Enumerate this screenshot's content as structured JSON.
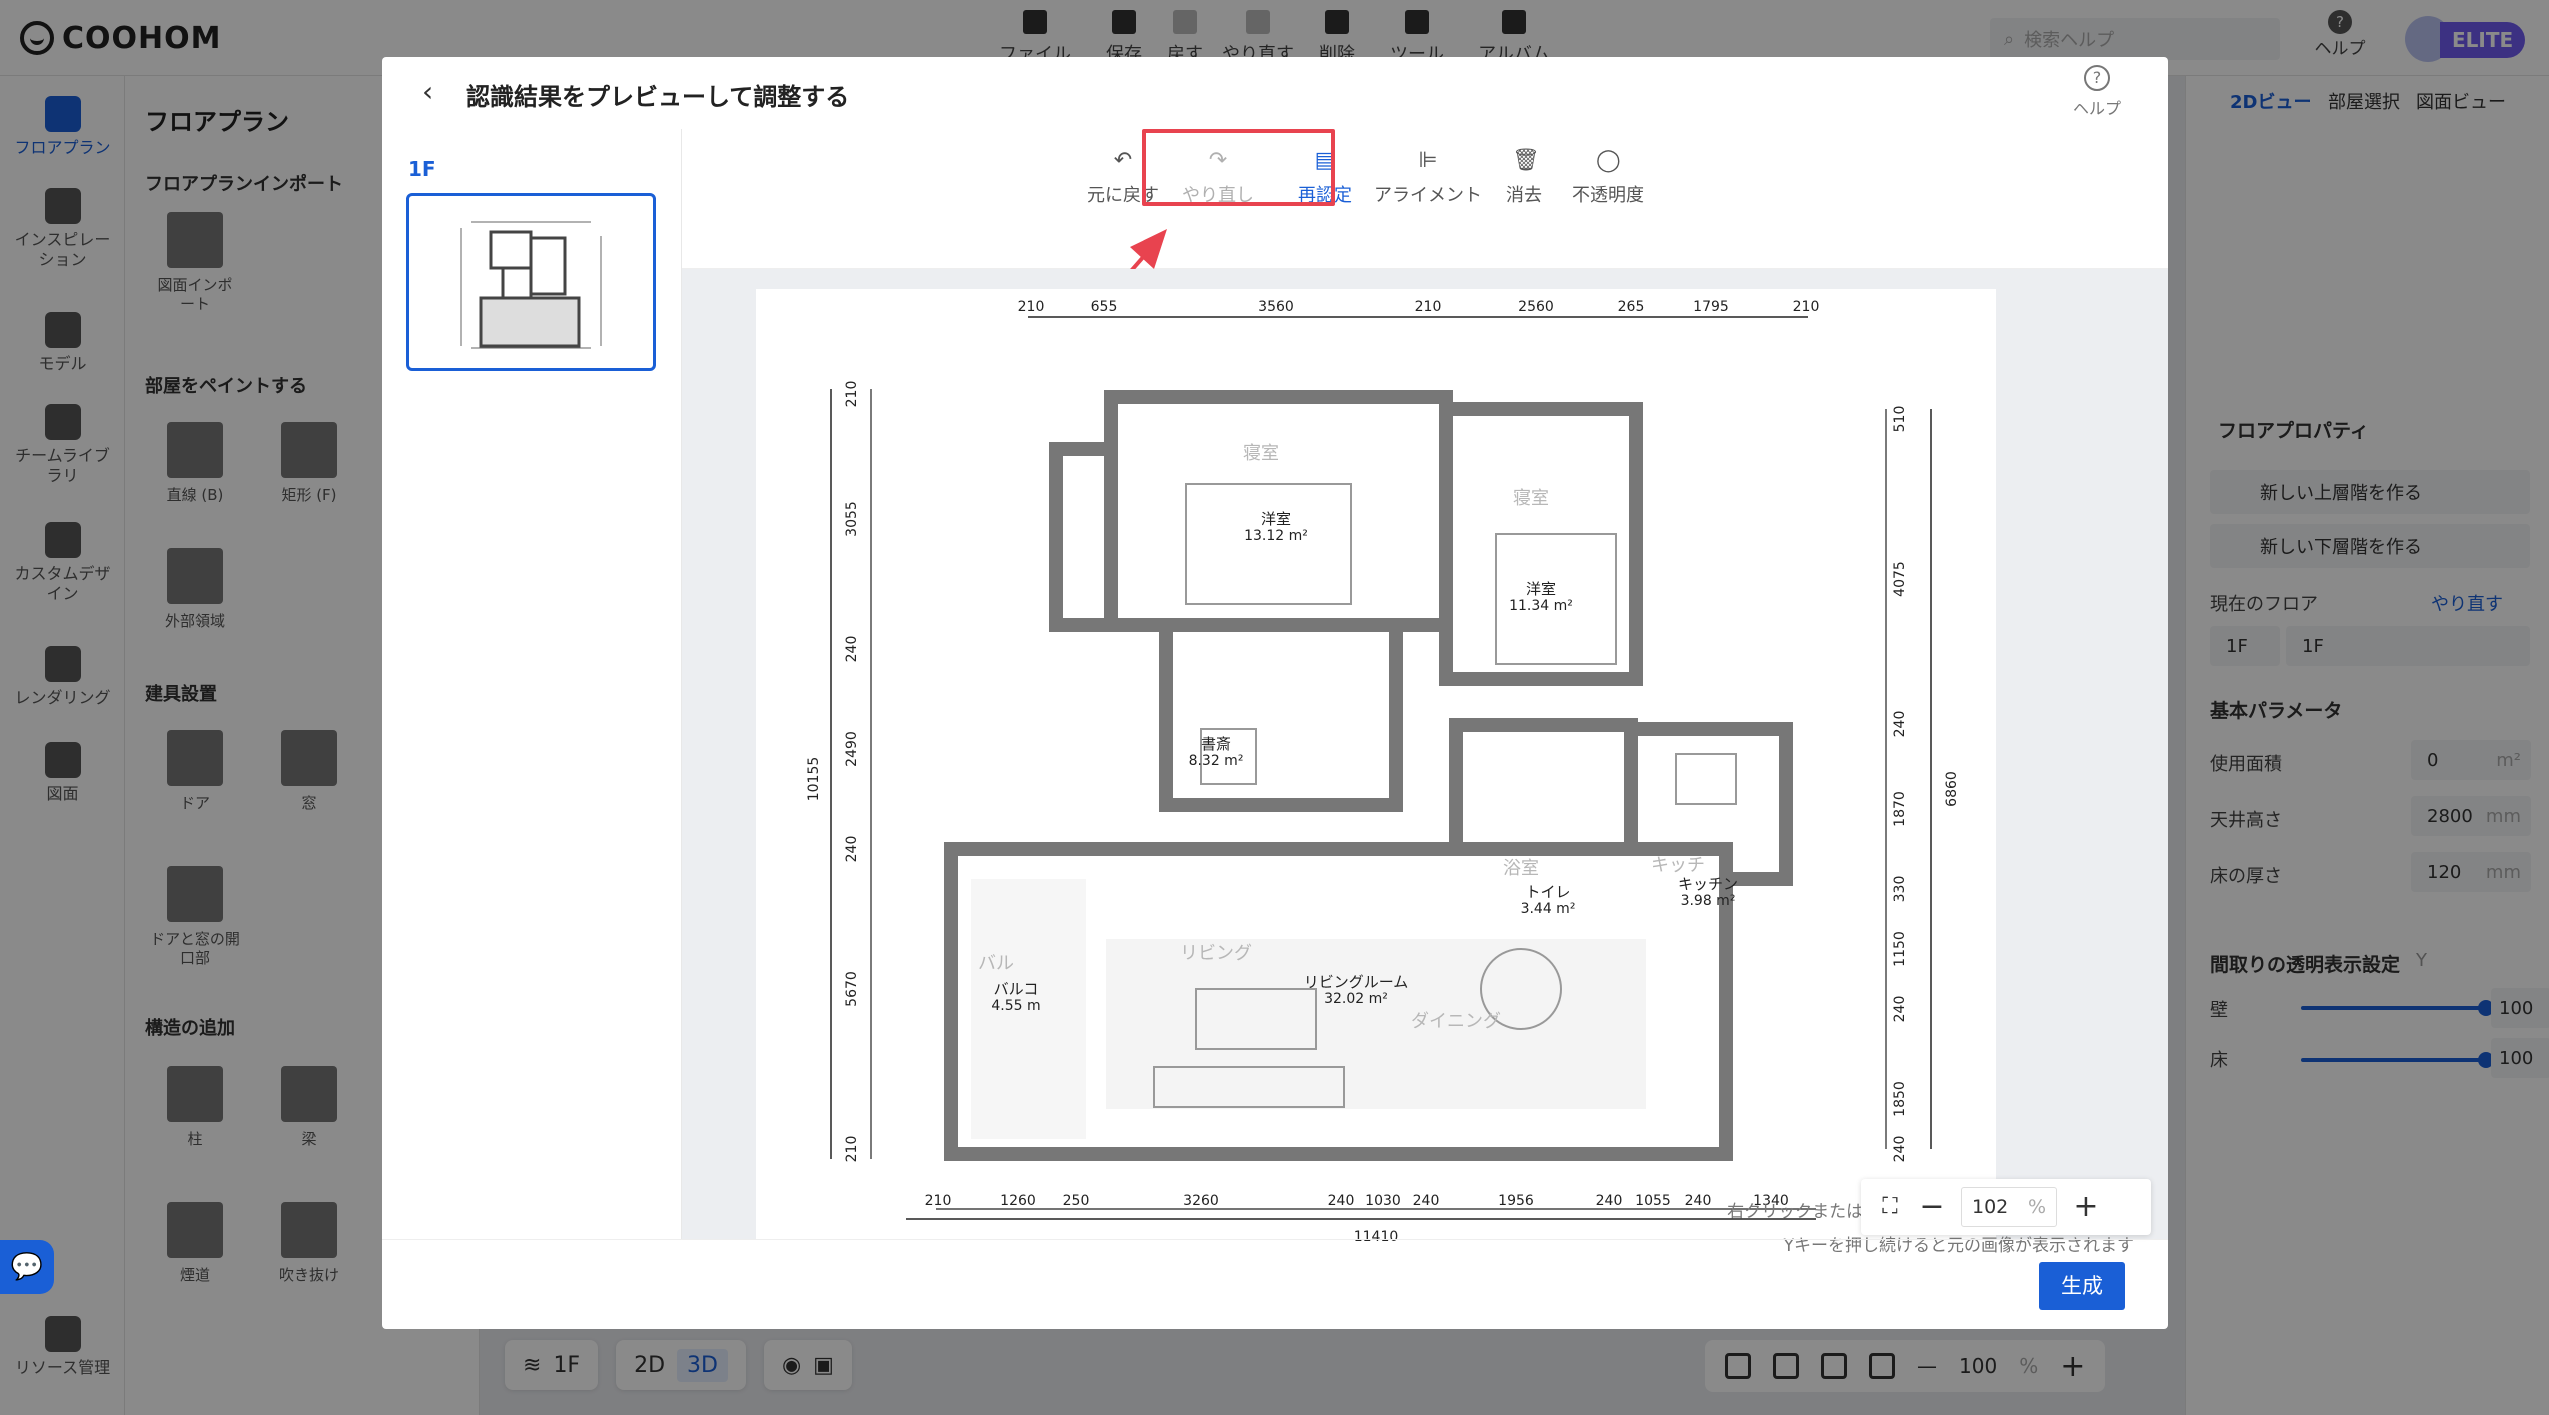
{
  "app": {
    "logo": "COOHOM",
    "top_tools": [
      "ファイル",
      "保存",
      "戻す",
      "やり直す",
      "削除",
      "ツール",
      "アルバム"
    ],
    "search_placeholder": "検索ヘルプ",
    "help": "ヘルプ",
    "badge": "ELITE"
  },
  "left_nav": [
    {
      "label": "フロアプラン",
      "icon": "floorplan-icon",
      "active": true
    },
    {
      "label": "インスピレーション",
      "icon": "bulb-icon",
      "active": false
    },
    {
      "label": "モデル",
      "icon": "sofa-icon",
      "active": false
    },
    {
      "label": "チームライブラリ",
      "icon": "crown-icon",
      "active": false
    },
    {
      "label": "カスタムデザイン",
      "icon": "box-icon",
      "active": false
    },
    {
      "label": "レンダリング",
      "icon": "camera-icon",
      "active": false
    },
    {
      "label": "図面",
      "icon": "drawing-icon",
      "active": false
    },
    {
      "label": "リソース管理",
      "icon": "resource-icon",
      "active": false
    }
  ],
  "left_panel": {
    "title": "フロアプラン",
    "import_section": "フロアプランインポート",
    "import_label": "図面インポート",
    "paint_section": "部屋をペイントする",
    "paint_tools": [
      "直線 (B)",
      "矩形 (F)",
      "外部領域"
    ],
    "fixture_section": "建具設置",
    "fixtures": [
      "ドア",
      "窓",
      "ドアと窓の開口部"
    ],
    "structure_section": "構造の追加",
    "structures": [
      "柱",
      "梁",
      "煙道",
      "吹き抜け"
    ]
  },
  "right_panel": {
    "tabs": [
      "2Dビュー",
      "部屋選択",
      "図面ビュー"
    ],
    "floor_props": "フロアプロパティ",
    "btn_upper": "新しい上層階を作る",
    "btn_lower": "新しい下層階を作る",
    "current_floor": "現在のフロア",
    "current_floor_link": "やり直す",
    "floor_select": "1F",
    "floor_name": "1F",
    "basic_params": "基本パラメータ",
    "usage_area": "使用面積",
    "usage_area_value": "0",
    "usage_area_unit": "m²",
    "ceiling_height": "天井高さ",
    "ceiling_height_value": "2800",
    "ceiling_height_unit": "mm",
    "floor_thickness": "床の厚さ",
    "floor_thickness_value": "120",
    "floor_thickness_unit": "mm",
    "transparency": "間取りの透明表示設定",
    "transparency_key": "Y",
    "wall": "壁",
    "wall_value": "100",
    "floor": "床",
    "floor_value": "100",
    "percent": "%"
  },
  "bottom_bar": {
    "floor": "1F",
    "view2d": "2D",
    "view3d": "3D",
    "zoom": "100",
    "percent": "%"
  },
  "modal": {
    "title": "認識結果をプレビューして調整する",
    "help": "ヘルプ",
    "floor_tab": "1F",
    "tools": [
      {
        "label": "元に戻す",
        "icon": "undo-icon",
        "state": "normal"
      },
      {
        "label": "やり直し",
        "icon": "redo-icon",
        "state": "disabled"
      },
      {
        "label": "再認定",
        "icon": "ai-recognize-icon",
        "state": "active"
      },
      {
        "label": "アライメント",
        "icon": "align-icon",
        "state": "normal"
      },
      {
        "label": "消去",
        "icon": "trash-icon",
        "state": "normal"
      },
      {
        "label": "不透明度",
        "icon": "opacity-icon",
        "state": "normal"
      }
    ],
    "hint1": "右クリックまたはESCキーを押して操作を終了します",
    "hint2": "Yキーを押し続けると元の画像が表示されます",
    "zoom_value": "102",
    "zoom_unit": "%",
    "generate": "生成"
  },
  "floorplan": {
    "top_dims": [
      "210",
      "655",
      "3560",
      "210",
      "2560",
      "265",
      "1795",
      "210"
    ],
    "bottom_dims": [
      "210",
      "1260",
      "250",
      "3260",
      "240",
      "1030",
      "240",
      "1956",
      "240",
      "1055",
      "240",
      "1340"
    ],
    "bottom_total": "11410",
    "left_dims": [
      "210",
      "3055",
      "240",
      "2490",
      "240",
      "5670",
      "210"
    ],
    "left_total": "10155",
    "right_dims": [
      "510",
      "4075",
      "240",
      "1870",
      "330",
      "1150",
      "240",
      "1850",
      "240"
    ],
    "right_total": "6860",
    "rooms": [
      {
        "name": "寝室",
        "faded": true
      },
      {
        "name": "洋室",
        "area": "13.12 m²"
      },
      {
        "name": "寝室",
        "faded": true
      },
      {
        "name": "洋室",
        "area": "11.34 m²"
      },
      {
        "name": "書斎",
        "area": "8.32 m²"
      },
      {
        "name": "浴室",
        "faded": true
      },
      {
        "name": "トイレ",
        "area": "3.44 m²"
      },
      {
        "name": "キッチ",
        "faded": true
      },
      {
        "name": "キッチン",
        "area": "3.98 m²"
      },
      {
        "name": "リビング",
        "faded": true
      },
      {
        "name": "リビングルーム",
        "area": "32.02 m²"
      },
      {
        "name": "バル",
        "faded": true
      },
      {
        "name": "バルコ",
        "area": "4.55 m"
      },
      {
        "name": "ダイニング",
        "faded": true
      }
    ]
  }
}
